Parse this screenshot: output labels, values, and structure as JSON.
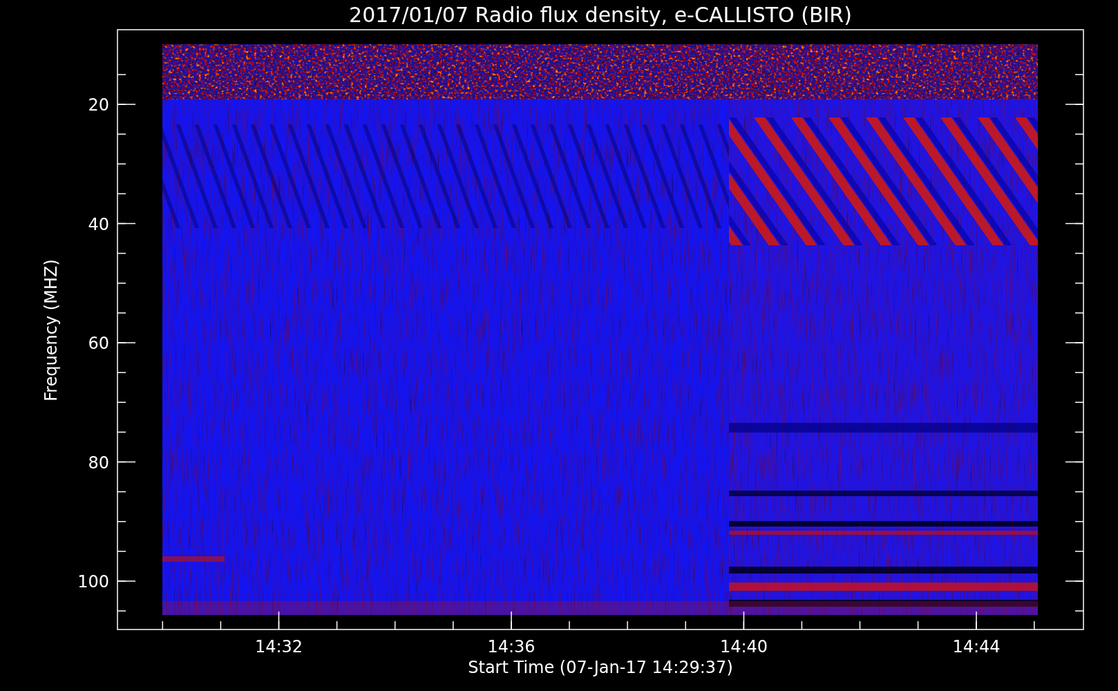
{
  "title": "2017/01/07  Radio flux density, e-CALLISTO (BIR)",
  "y_axis": {
    "label": "Frequency (MHZ)",
    "ticks": [
      "20",
      "40",
      "60",
      "80",
      "100"
    ]
  },
  "x_axis": {
    "label": "Start Time (07-Jan-17 14:29:37)",
    "ticks": [
      "14:32",
      "14:36",
      "14:40",
      "14:44"
    ]
  }
}
